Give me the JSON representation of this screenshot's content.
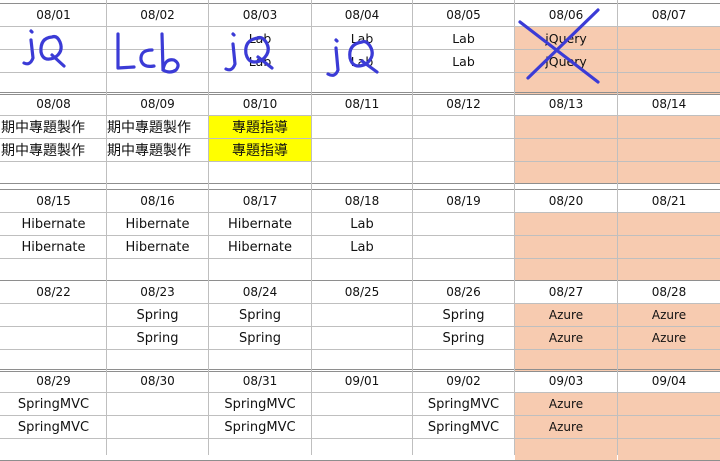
{
  "weeks": [
    {
      "dates": [
        "08/01",
        "08/02",
        "08/03",
        "08/04",
        "08/05",
        "08/06",
        "08/07"
      ],
      "row1": [
        "",
        "",
        "Lab",
        "Lab",
        "Lab",
        "jQuery",
        ""
      ],
      "row2": [
        "",
        "",
        "Lab",
        "Lab",
        "Lab",
        "jQuery",
        ""
      ]
    },
    {
      "dates": [
        "08/08",
        "08/09",
        "08/10",
        "08/11",
        "08/12",
        "08/13",
        "08/14"
      ],
      "row1": [
        "期中專題製作",
        "期中專題製作",
        "專題指導",
        "",
        "",
        "",
        ""
      ],
      "row2": [
        "期中專題製作",
        "期中專題製作",
        "專題指導",
        "",
        "",
        "",
        ""
      ]
    },
    {
      "dates": [
        "08/15",
        "08/16",
        "08/17",
        "08/18",
        "08/19",
        "08/20",
        "08/21"
      ],
      "row1": [
        "Hibernate",
        "Hibernate",
        "Hibernate",
        "Lab",
        "",
        "",
        ""
      ],
      "row2": [
        "Hibernate",
        "Hibernate",
        "Hibernate",
        "Lab",
        "",
        "",
        ""
      ]
    },
    {
      "dates": [
        "08/22",
        "08/23",
        "08/24",
        "08/25",
        "08/26",
        "08/27",
        "08/28"
      ],
      "row1": [
        "",
        "Spring",
        "Spring",
        "",
        "Spring",
        "Azure",
        "Azure"
      ],
      "row2": [
        "",
        "Spring",
        "Spring",
        "",
        "Spring",
        "Azure",
        "Azure"
      ]
    },
    {
      "dates": [
        "08/29",
        "08/30",
        "08/31",
        "09/01",
        "09/02",
        "09/03",
        "09/04"
      ],
      "row1": [
        "SpringMVC",
        "",
        "SpringMVC",
        "",
        "SpringMVC",
        "Azure",
        ""
      ],
      "row2": [
        "SpringMVC",
        "",
        "SpringMVC",
        "",
        "SpringMVC",
        "Azure",
        ""
      ]
    }
  ],
  "handwritten": {
    "ink_color": "#3b3bd6",
    "notes": [
      "jQ",
      "Lcb",
      "jQ",
      "jQ"
    ],
    "crossed_out_day": "08/06"
  },
  "colors": {
    "weekend_fill": "#f7cbb0",
    "highlight_fill": "#ffff00",
    "grid_line": "#bfbfbf"
  }
}
